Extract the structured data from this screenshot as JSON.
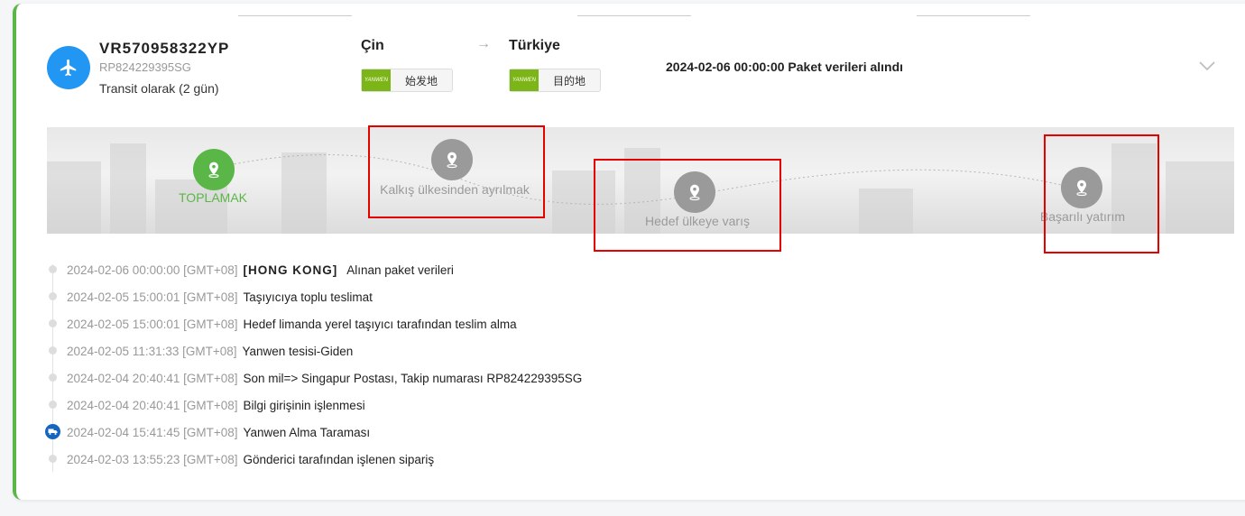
{
  "shipment": {
    "tracking_number": "VR570958322YP",
    "secondary_number": "RP824229395SG",
    "transit_text": "Transit olarak (2 gün)",
    "icon": "plane-icon"
  },
  "route": {
    "origin": {
      "country": "Çin",
      "carrier_tag": "始发地",
      "carrier_logo_text": "YANWEN"
    },
    "destination": {
      "country": "Türkiye",
      "carrier_tag": "目的地",
      "carrier_logo_text": "YANWEN"
    }
  },
  "latest_event": "2024-02-06 00:00:00 Paket verileri alındı",
  "stages": [
    {
      "label": "TOPLAMAK",
      "active": true
    },
    {
      "label": "Kalkış ülkesinden ayrılmak",
      "active": false
    },
    {
      "label": "Hedef ülkeye varış",
      "active": false
    },
    {
      "label": "Başarılı yatırım",
      "active": false
    }
  ],
  "events": [
    {
      "time": "2024-02-06 00:00:00 [GMT+08]",
      "location": "[HONG KONG]",
      "description": "Alınan paket verileri"
    },
    {
      "time": "2024-02-05 15:00:01 [GMT+08]",
      "location": "",
      "description": "Taşıyıcıya toplu teslimat"
    },
    {
      "time": "2024-02-05 15:00:01 [GMT+08]",
      "location": "",
      "description": "Hedef limanda yerel taşıyıcı tarafından teslim alma"
    },
    {
      "time": "2024-02-05 11:31:33 [GMT+08]",
      "location": "",
      "description": "Yanwen tesisi-Giden"
    },
    {
      "time": "2024-02-04 20:40:41 [GMT+08]",
      "location": "",
      "description": "Son mil=> Singapur Postası, Takip numarası RP824229395SG"
    },
    {
      "time": "2024-02-04 20:40:41 [GMT+08]",
      "location": "",
      "description": "Bilgi girişinin işlenmesi"
    },
    {
      "time": "2024-02-04 15:41:45 [GMT+08]",
      "location": "",
      "description": "Yanwen Alma Taraması"
    },
    {
      "time": "2024-02-03 13:55:23 [GMT+08]",
      "location": "",
      "description": "Gönderici tarafından işlenen sipariş"
    }
  ],
  "colors": {
    "accent_green": "#5ab646",
    "plane_blue": "#2196f3",
    "highlight_red": "#e60000",
    "truck_blue": "#1565c0"
  }
}
